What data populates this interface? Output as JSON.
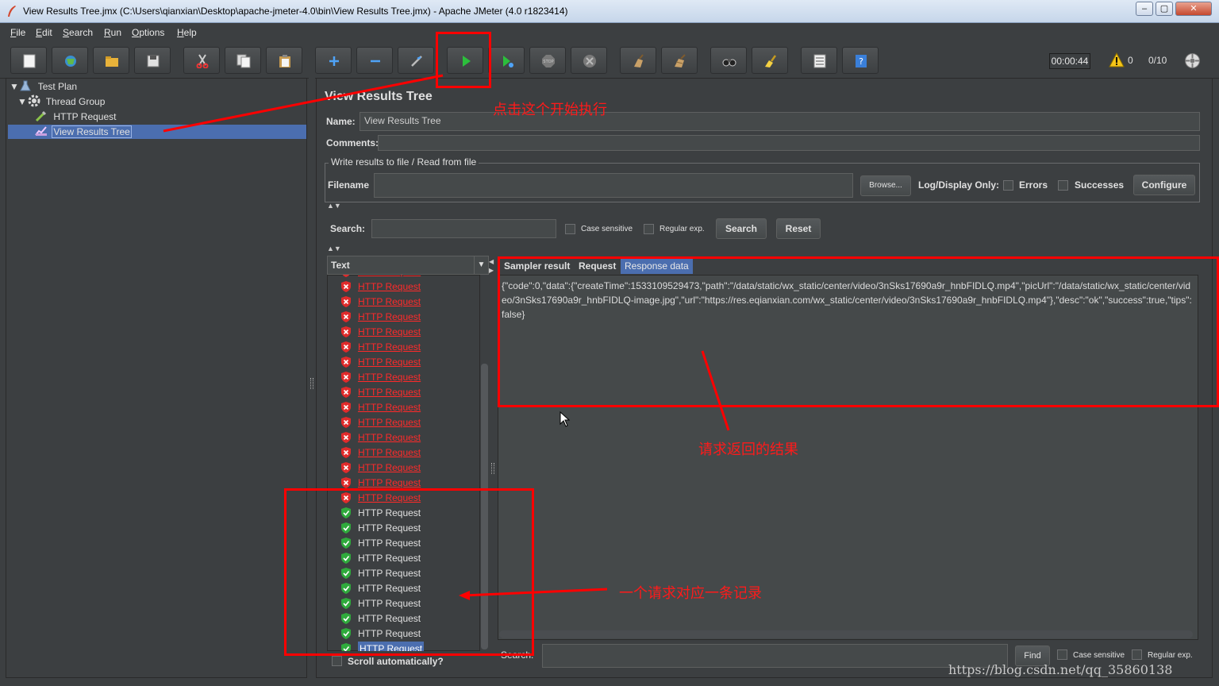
{
  "window": {
    "title": "View Results Tree.jmx (C:\\Users\\qianxian\\Desktop\\apache-jmeter-4.0\\bin\\View Results Tree.jmx) - Apache JMeter (4.0 r1823414)"
  },
  "menu": [
    "File",
    "Edit",
    "Search",
    "Run",
    "Options",
    "Help"
  ],
  "toolbar": {
    "timer": "00:00:44",
    "warnings": "0",
    "threads": "0/10"
  },
  "tree": {
    "test_plan": "Test Plan",
    "thread_group": "Thread Group",
    "http_request": "HTTP Request",
    "view_results_tree": "View Results Tree"
  },
  "panel": {
    "title": "View Results Tree",
    "name_label": "Name:",
    "name_value": "View Results Tree",
    "comments_label": "Comments:",
    "write_results_legend": "Write results to file / Read from file",
    "filename_label": "Filename",
    "browse_btn": "Browse...",
    "log_display_label": "Log/Display Only:",
    "errors_label": "Errors",
    "successes_label": "Successes",
    "configure_btn": "Configure",
    "search_label": "Search:",
    "case_sensitive": "Case sensitive",
    "regular_exp": "Regular exp.",
    "search_btn": "Search",
    "reset_btn": "Reset",
    "renderer": "Text",
    "scroll_auto": "Scroll automatically?"
  },
  "tabs": [
    "Sampler result",
    "Request",
    "Response data"
  ],
  "response_text": "{\"code\":0,\"data\":{\"createTime\":1533109529473,\"path\":\"/data/static/wx_static/center/video/3nSks17690a9r_hnbFIDLQ.mp4\",\"picUrl\":\"/data/static/wx_static/center/video/3nSks17690a9r_hnbFIDLQ-image.jpg\",\"url\":\"https://res.eqianxian.com/wx_static/center/video/3nSks17690a9r_hnbFIDLQ.mp4\"},\"desc\":\"ok\",\"success\":true,\"tips\":false}",
  "samples_failed": [
    "HTTP Request",
    "HTTP Request",
    "HTTP Request",
    "HTTP Request",
    "HTTP Request",
    "HTTP Request",
    "HTTP Request",
    "HTTP Request",
    "HTTP Request",
    "HTTP Request",
    "HTTP Request",
    "HTTP Request",
    "HTTP Request",
    "HTTP Request",
    "HTTP Request",
    "HTTP Request"
  ],
  "samples_ok": [
    "HTTP Request",
    "HTTP Request",
    "HTTP Request",
    "HTTP Request",
    "HTTP Request",
    "HTTP Request",
    "HTTP Request",
    "HTTP Request",
    "HTTP Request",
    "HTTP Request"
  ],
  "bottom_search": {
    "label": "Search:",
    "find_btn": "Find",
    "case_sensitive": "Case sensitive",
    "regular_exp": "Regular exp."
  },
  "annotations": {
    "start": "点击这个开始执行",
    "result": "请求返回的结果",
    "record": "一个请求对应一条记录"
  },
  "watermark": "https://blog.csdn.net/qq_35860138",
  "colors": {
    "background": "#3c3f41",
    "selection": "#4b6eaf",
    "fail": "#ff2a2a",
    "annotation": "#ff0000"
  }
}
